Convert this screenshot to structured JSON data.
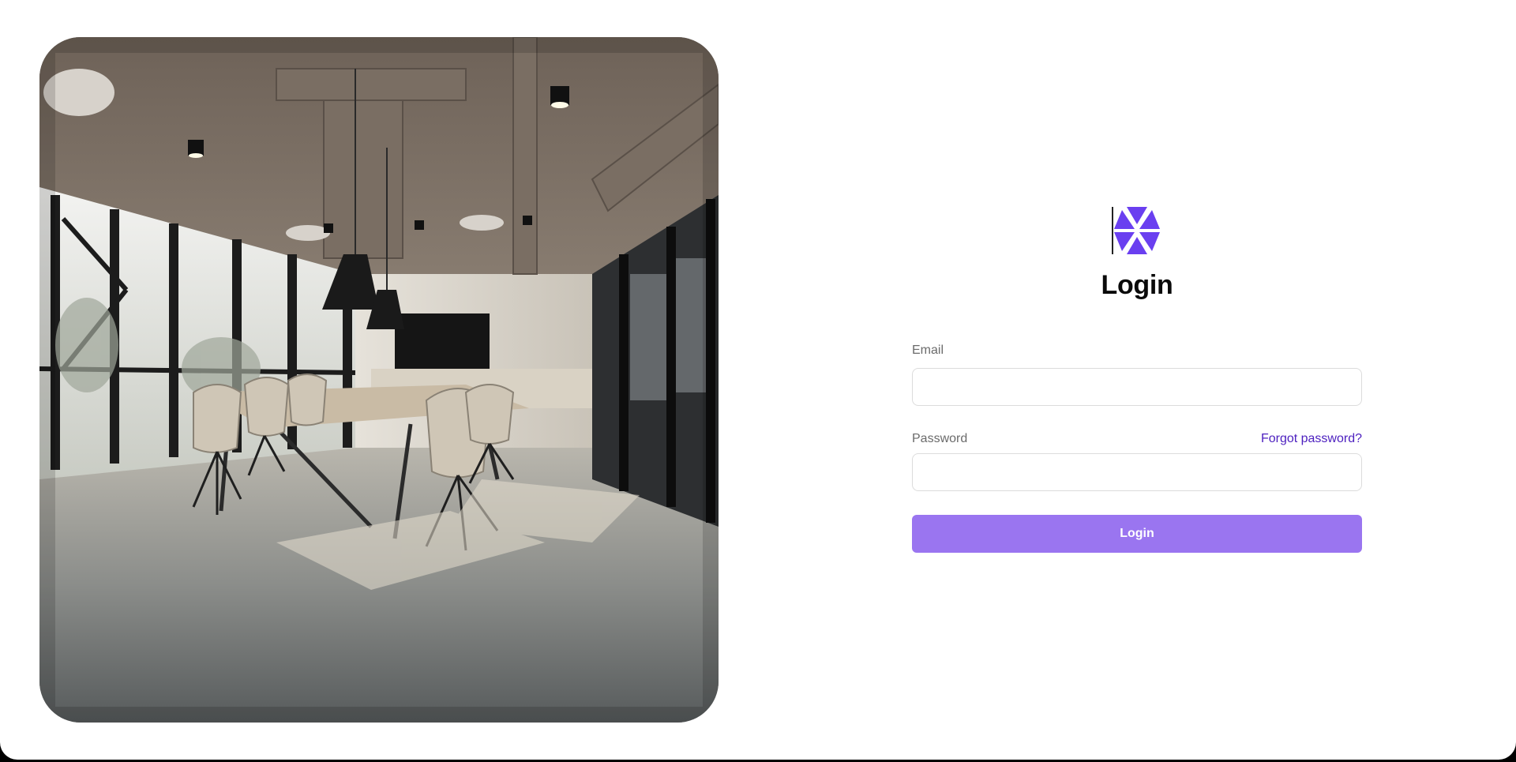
{
  "brand": {
    "logo_icon": "hexagon-triangles-logo",
    "accent_color": "#6a3ff0",
    "button_color": "#9a75f0",
    "link_color": "#4c1fbf"
  },
  "photo": {
    "icon": "office-meeting-room-photo"
  },
  "login": {
    "title": "Login",
    "email_label": "Email",
    "email_value": "",
    "password_label": "Password",
    "password_value": "",
    "forgot_password_label": "Forgot password?",
    "submit_label": "Login"
  }
}
